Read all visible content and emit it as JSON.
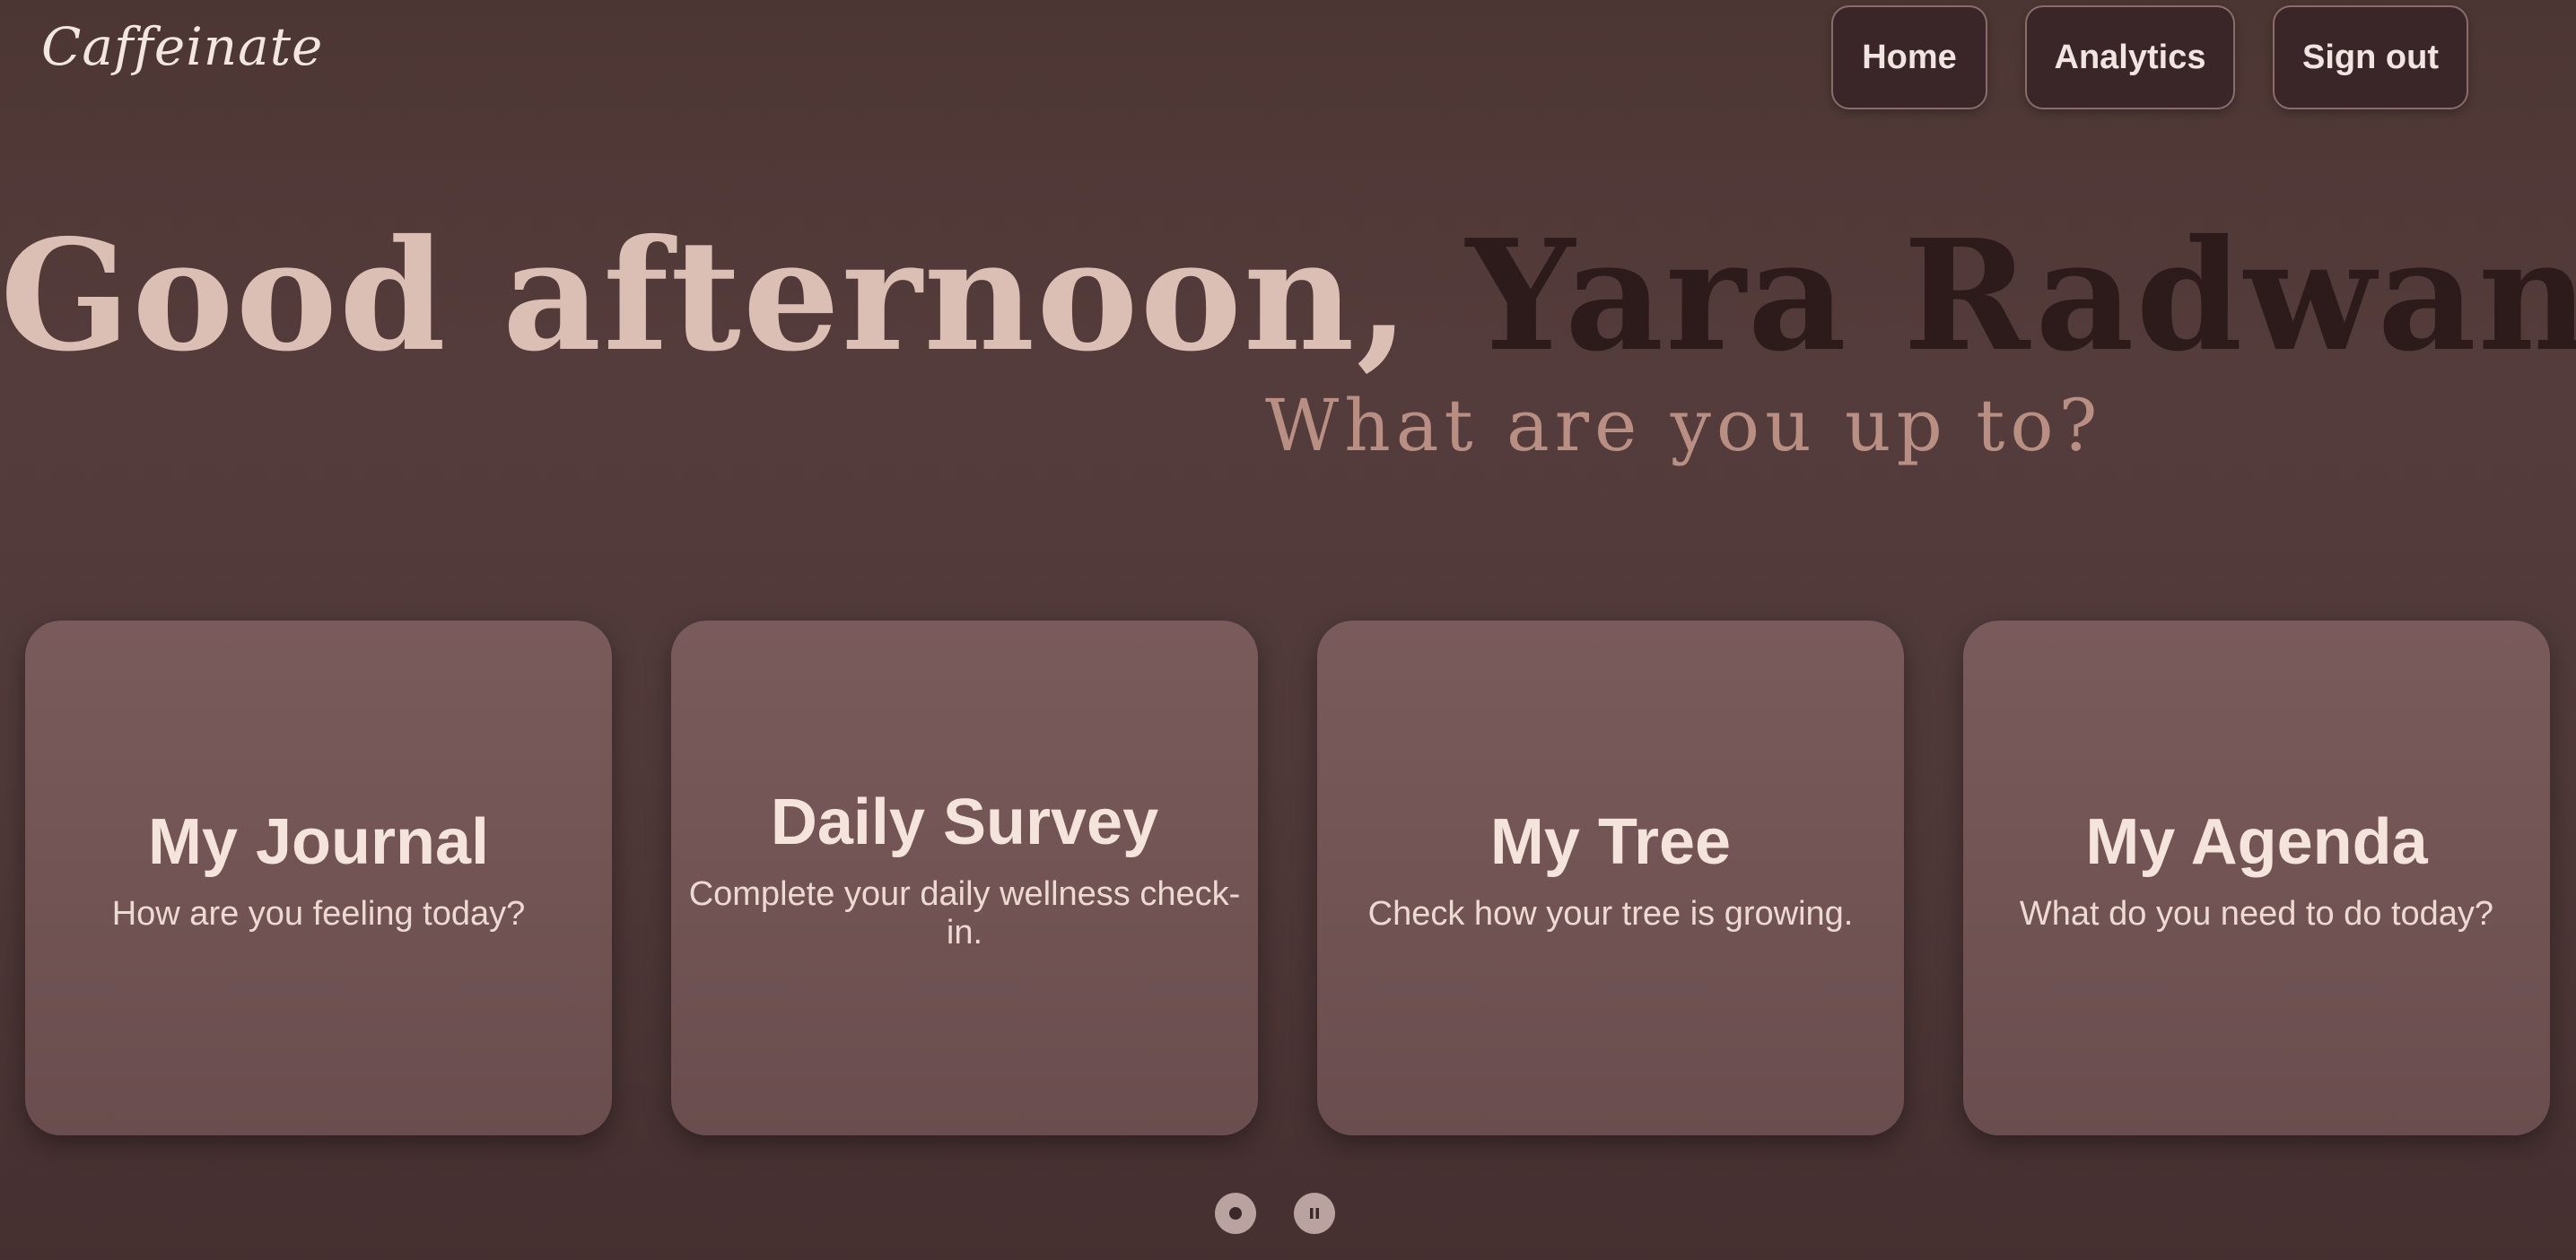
{
  "app": {
    "logo": "Caffeinate"
  },
  "nav": {
    "home_label": "Home",
    "analytics_label": "Analytics",
    "signout_label": "Sign out"
  },
  "hero": {
    "greeting": "Good afternoon,",
    "user_name": "Yara Radwan",
    "subtitle": "What are you up to?"
  },
  "cards": [
    {
      "title": "My Journal",
      "description": "How are you feeling today?"
    },
    {
      "title": "Daily Survey",
      "description": "Complete your daily wellness check-in."
    },
    {
      "title": "My Tree",
      "description": "Check how your tree is growing."
    },
    {
      "title": "My Agenda",
      "description": "What do you need to do today?"
    }
  ],
  "carousel": {
    "controls": [
      "carousel-dot-icon",
      "pause-icon"
    ]
  },
  "colors": {
    "background": "#503939",
    "card": "#735555",
    "nav_button": "#3a2628",
    "greeting": "#dcbfb4",
    "name": "#2d1b1c",
    "subtitle": "#b98f84"
  }
}
